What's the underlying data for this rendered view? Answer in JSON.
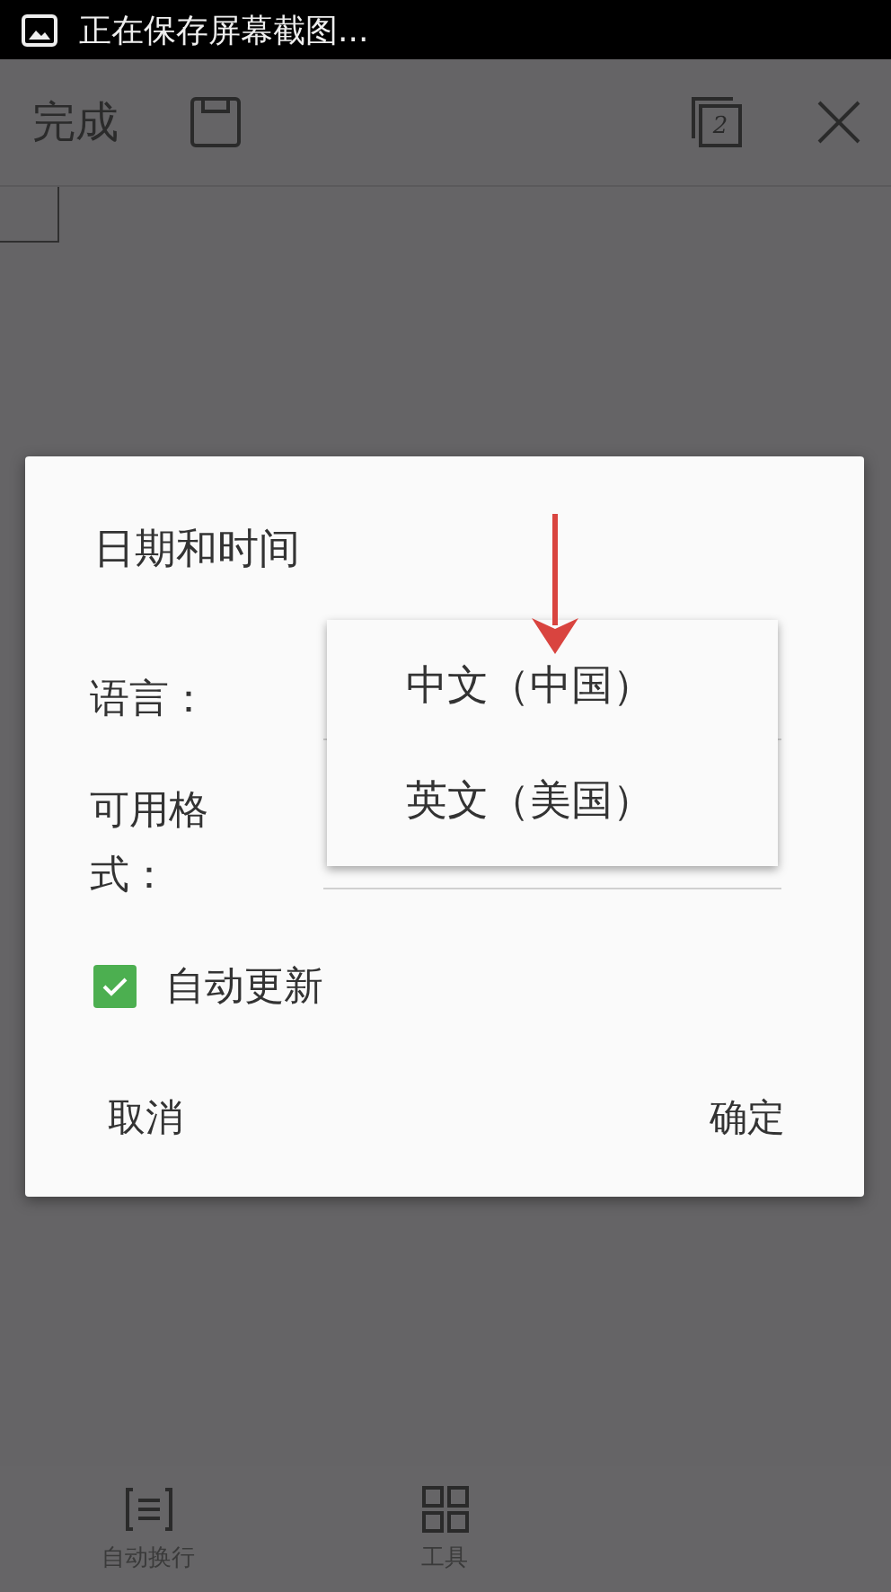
{
  "status_bar": {
    "notification": "正在保存屏幕截图..."
  },
  "toolbar": {
    "done": "完成",
    "page_count": "2"
  },
  "bottom_bar": {
    "items": [
      {
        "label": "自动换行",
        "kind": "wrap"
      },
      {
        "label": "工具",
        "kind": "tools"
      }
    ]
  },
  "dialog": {
    "title": "日期和时间",
    "language_label": "语言：",
    "format_label": "可用格式：",
    "auto_update": {
      "label": "自动更新",
      "checked": true
    },
    "buttons": [
      "取消",
      "确定"
    ]
  },
  "dropdown": {
    "options": [
      {
        "label": "中文（中国）"
      },
      {
        "label": "英文（美国）"
      }
    ]
  }
}
